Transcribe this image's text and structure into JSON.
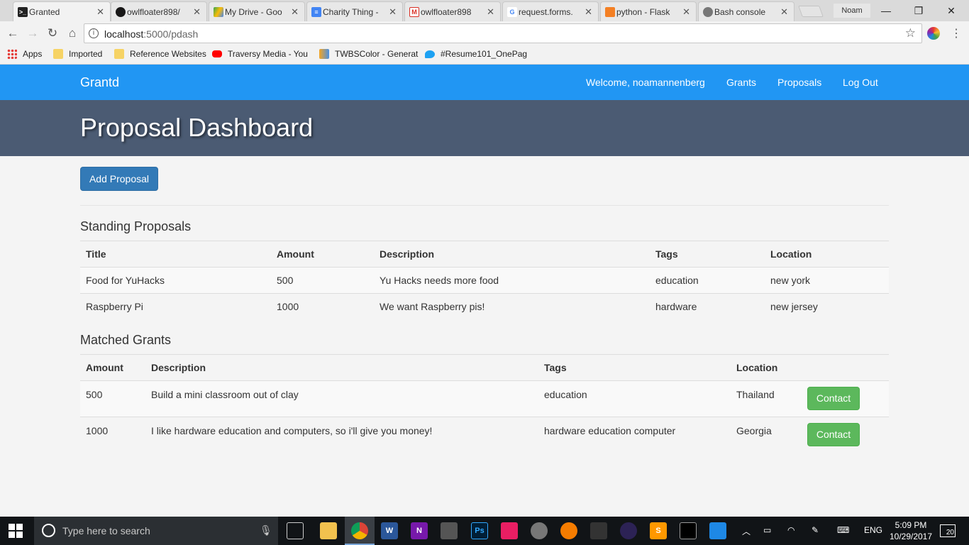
{
  "browser": {
    "tabs": [
      {
        "title": "Granted",
        "icon": "terminal-icon",
        "color": "#222222"
      },
      {
        "title": "owlfloater898/",
        "icon": "github-icon",
        "color": "#181717"
      },
      {
        "title": "My Drive - Goo",
        "icon": "drive-icon",
        "color": "#1e88e5"
      },
      {
        "title": "Charity Thing -",
        "icon": "docs-icon",
        "color": "#4285f4"
      },
      {
        "title": "owlfloater898",
        "icon": "gmail-icon",
        "color": "#d93025"
      },
      {
        "title": "request.forms.",
        "icon": "google-icon",
        "color": "#4285f4"
      },
      {
        "title": "python - Flask",
        "icon": "stackoverflow-icon",
        "color": "#f48024"
      },
      {
        "title": "Bash console",
        "icon": "pythonanywhere-icon",
        "color": "#555555"
      }
    ],
    "close_glyph": "✕",
    "profile": "Noam",
    "url_host": "localhost",
    "url_path": ":5000/pdash",
    "bookmarks": [
      {
        "label": "Apps",
        "icon": "apps-grid-icon",
        "color": "#e53935"
      },
      {
        "label": "Imported",
        "icon": "folder-icon",
        "color": "#f6d365"
      },
      {
        "label": "Reference Websites",
        "icon": "folder-icon",
        "color": "#f6d365"
      },
      {
        "label": "Traversy Media - You",
        "icon": "youtube-icon",
        "color": "#ff0000"
      },
      {
        "label": "TWBSColor - Generat",
        "icon": "twbscolor-icon",
        "color": "#f5a623"
      },
      {
        "label": "#Resume101_OnePag",
        "icon": "twitter-icon",
        "color": "#1da1f2"
      }
    ]
  },
  "navbar": {
    "brand": "Grantd",
    "welcome": "Welcome, noamannenberg",
    "grants": "Grants",
    "proposals": "Proposals",
    "logout": "Log Out"
  },
  "jumbotron": {
    "title": "Proposal Dashboard"
  },
  "add_proposal_label": "Add Proposal",
  "standing": {
    "title": "Standing Proposals",
    "headers": [
      "Title",
      "Amount",
      "Description",
      "Tags",
      "Location"
    ],
    "rows": [
      [
        "Food for YuHacks",
        "500",
        "Yu Hacks needs more food",
        "education",
        "new york"
      ],
      [
        "Raspberry Pi",
        "1000",
        "We want Raspberry pis!",
        "hardware",
        "new jersey"
      ]
    ]
  },
  "matched": {
    "title": "Matched Grants",
    "headers": [
      "Amount",
      "Description",
      "Tags",
      "Location",
      ""
    ],
    "contact_label": "Contact",
    "rows": [
      [
        "500",
        "Build a mini classroom out of clay",
        "education",
        "Thailand"
      ],
      [
        "1000",
        "I like hardware education and computers, so i'll give you money!",
        "hardware education computer",
        "Georgia"
      ]
    ]
  },
  "taskbar": {
    "search_placeholder": "Type here to search",
    "lang": "ENG",
    "time": "5:09 PM",
    "date": "10/29/2017",
    "notifications": "20"
  },
  "colors": {
    "navbar": "#2196f3",
    "jumbotron": "#4b5b73",
    "primary": "#337ab7",
    "success": "#5cb85c"
  }
}
